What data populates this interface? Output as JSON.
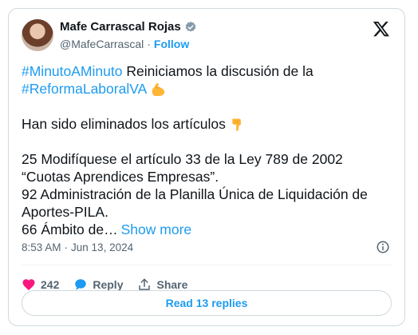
{
  "author": {
    "name": "Mafe Carrascal Rojas",
    "handle": "@MafeCarrascal",
    "separator": "·",
    "follow_label": "Follow"
  },
  "tweet": {
    "line1_hashtag": "#MinutoAMinuto",
    "line1_text": " Reiniciamos la discusión de la",
    "line2_hashtag": "#ReformaLaboralVA",
    "line3": "Han sido eliminados los artículos",
    "line4": "25 Modifíquese el artículo 33 de la Ley 789 de 2002",
    "line5": "“Cuotas Aprendices Empresas”.",
    "line6": "92 Administración de la Planilla Única de Liquidación de",
    "line7": "Aportes-PILA.",
    "line8": "66 Ámbito de…",
    "show_more": "Show more"
  },
  "meta": {
    "time": "8:53 AM",
    "separator": "·",
    "date": "Jun 13, 2024"
  },
  "actions": {
    "likes": "242",
    "reply_label": "Reply",
    "share_label": "Share"
  },
  "read_replies_label": "Read 13 replies",
  "colors": {
    "accent": "#1d9bf0",
    "like": "#f91880",
    "text": "#0f1419",
    "muted": "#536471",
    "border": "#cfd9de"
  },
  "icons": [
    "verified-badge-icon",
    "x-logo-icon",
    "flexed-biceps-emoji",
    "pointing-down-emoji",
    "info-icon",
    "heart-icon",
    "reply-bubble-icon",
    "share-icon"
  ]
}
